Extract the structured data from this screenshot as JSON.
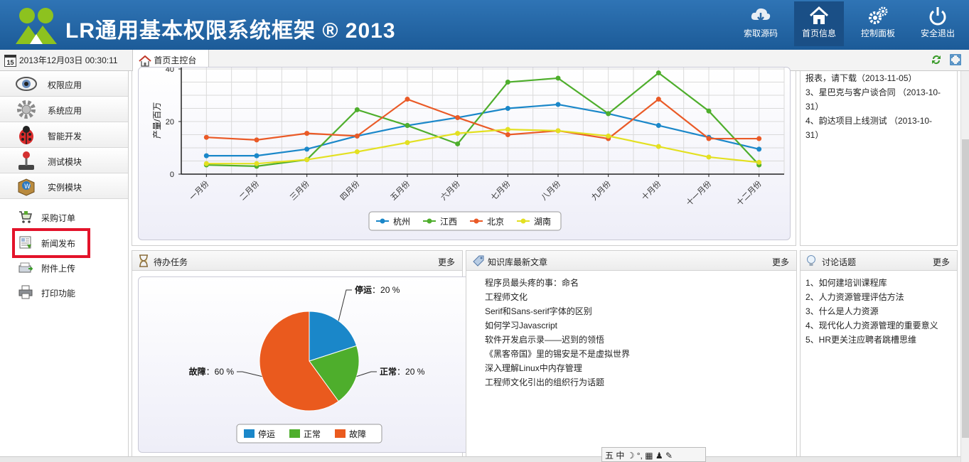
{
  "header": {
    "title": "LR通用基本权限系统框架 ® 2013",
    "buttons": [
      {
        "label": "索取源码",
        "icon": "cloud-download-icon"
      },
      {
        "label": "首页信息",
        "icon": "home-icon"
      },
      {
        "label": "控制面板",
        "icon": "gears-icon"
      },
      {
        "label": "安全退出",
        "icon": "power-icon"
      }
    ]
  },
  "tabbar": {
    "calendar_day": "15",
    "datetime": "2013年12月03日 00:30:11",
    "home_tab": "首页主控台"
  },
  "sidebar": {
    "modules": [
      {
        "label": "权限应用",
        "icon": "eye-icon"
      },
      {
        "label": "系统应用",
        "icon": "gear-icon"
      },
      {
        "label": "智能开发",
        "icon": "ladybug-icon"
      },
      {
        "label": "测试模块",
        "icon": "joystick-icon"
      },
      {
        "label": "实例模块",
        "icon": "package-icon"
      }
    ],
    "items": [
      {
        "label": "采购订单",
        "icon": "cart-icon"
      },
      {
        "label": "新闻发布",
        "icon": "news-icon"
      },
      {
        "label": "附件上传",
        "icon": "upload-icon"
      },
      {
        "label": "打印功能",
        "icon": "printer-icon"
      }
    ]
  },
  "notices": {
    "lines": [
      "报表，请下载（2013-11-05）",
      "3、星巴克与客户谈合同 （2013-10-",
      "31）",
      "4、韵达项目上线测试 （2013-10-",
      "31）"
    ]
  },
  "tasks": {
    "title": "待办任务",
    "more": "更多",
    "pie": {
      "labels": [
        {
          "name": "停运",
          "text": "：20 %"
        },
        {
          "name": "正常",
          "text": "：20 %"
        },
        {
          "name": "故障",
          "text": "：60 %"
        }
      ]
    }
  },
  "knowledge": {
    "title": "知识库最新文章",
    "more": "更多",
    "articles": [
      "程序员最头疼的事：命名",
      "工程师文化",
      "Serif和Sans-serif字体的区别",
      "如何学习Javascript",
      "软件开发启示录——迟到的领悟",
      "《黑客帝国》里的锡安是不是虚拟世界",
      "深入理解Linux中内存管理",
      "工程师文化引出的组织行为话题"
    ]
  },
  "discussion": {
    "title": "讨论话题",
    "more": "更多",
    "topics": [
      "1、如何建培训课程库",
      "2、人力资源管理评估方法",
      "3、什么是人力资源",
      "4、现代化人力资源管理的重要意义",
      "5、HR更关注应聘者跳槽思维"
    ]
  },
  "ime": {
    "text": "五 中 ☽ °, ▦ ♟ ✎"
  },
  "chart_data": [
    {
      "type": "line",
      "title": "",
      "xlabel": "",
      "ylabel": "产量/百万",
      "ylim": [
        0,
        50
      ],
      "yticks": [
        0,
        20,
        40
      ],
      "grid": true,
      "legend": "bottom",
      "categories": [
        "一月份",
        "二月份",
        "三月份",
        "四月份",
        "五月份",
        "六月份",
        "七月份",
        "八月份",
        "九月份",
        "十月份",
        "十一月份",
        "十二月份"
      ],
      "series": [
        {
          "name": "杭州",
          "color": "#1a87c9",
          "values": [
            7,
            7,
            9.5,
            14.5,
            18.5,
            21.5,
            25,
            26.5,
            23,
            18.5,
            14,
            9.5
          ]
        },
        {
          "name": "江西",
          "color": "#4eae2c",
          "values": [
            3.5,
            3,
            5.5,
            24.5,
            18.5,
            11.5,
            35,
            36.5,
            23,
            38.5,
            24,
            3.5
          ]
        },
        {
          "name": "北京",
          "color": "#ea5a27",
          "values": [
            14,
            13,
            15.5,
            14.5,
            28.5,
            21.5,
            15,
            16.5,
            13.5,
            28.5,
            13.5,
            13.5
          ]
        },
        {
          "name": "湖南",
          "color": "#e3e021",
          "values": [
            4,
            4,
            5.5,
            8.5,
            12,
            15.5,
            17,
            16.5,
            14.5,
            10.5,
            6.5,
            4.5
          ]
        }
      ]
    },
    {
      "type": "pie",
      "legend": "bottom",
      "categories": [
        "停运",
        "正常",
        "故障"
      ],
      "values": [
        20,
        20,
        60
      ],
      "colors": [
        "#1a87c9",
        "#4eae2c",
        "#ea5a1e"
      ]
    }
  ]
}
